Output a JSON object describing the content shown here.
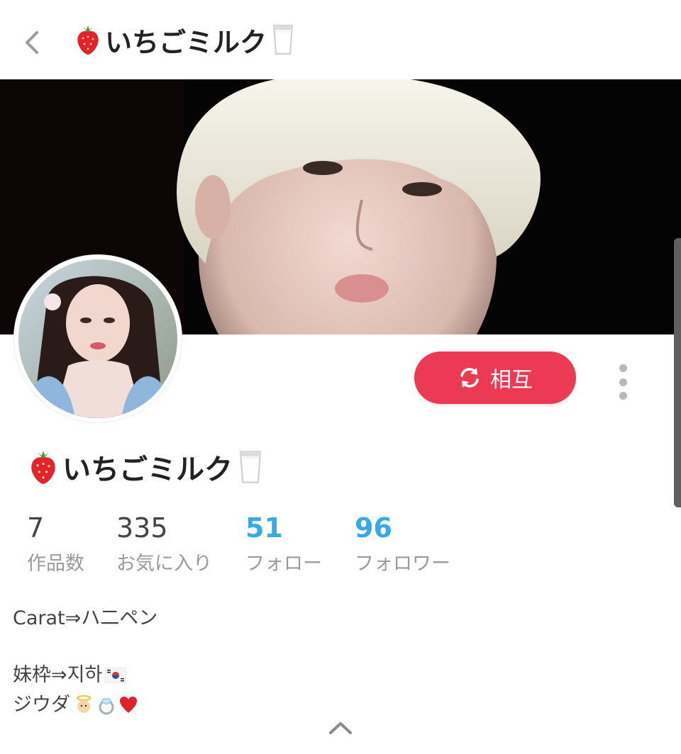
{
  "header": {
    "title": "いちごミルク"
  },
  "profile": {
    "display_name": "いちごミルク",
    "relationship_button_label": "相互",
    "stats": [
      {
        "value": "7",
        "label": "作品数",
        "accent": false
      },
      {
        "value": "335",
        "label": "お気に入り",
        "accent": false
      },
      {
        "value": "51",
        "label": "フォロー",
        "accent": true
      },
      {
        "value": "96",
        "label": "フォロワー",
        "accent": true
      }
    ],
    "bio": {
      "line1": "Carat⇒ハ二ペン",
      "line2": "妹枠⇒지하",
      "line3": "ジウダ"
    }
  },
  "colors": {
    "accent_red": "#ec3a55",
    "accent_blue": "#37a9e6"
  },
  "icons": {
    "back": "chevron-left-icon",
    "strawberry": "strawberry-icon",
    "milk": "milk-glass-icon",
    "mutual": "refresh-icon",
    "more": "more-vertical-icon",
    "expand": "chevron-up-icon"
  }
}
